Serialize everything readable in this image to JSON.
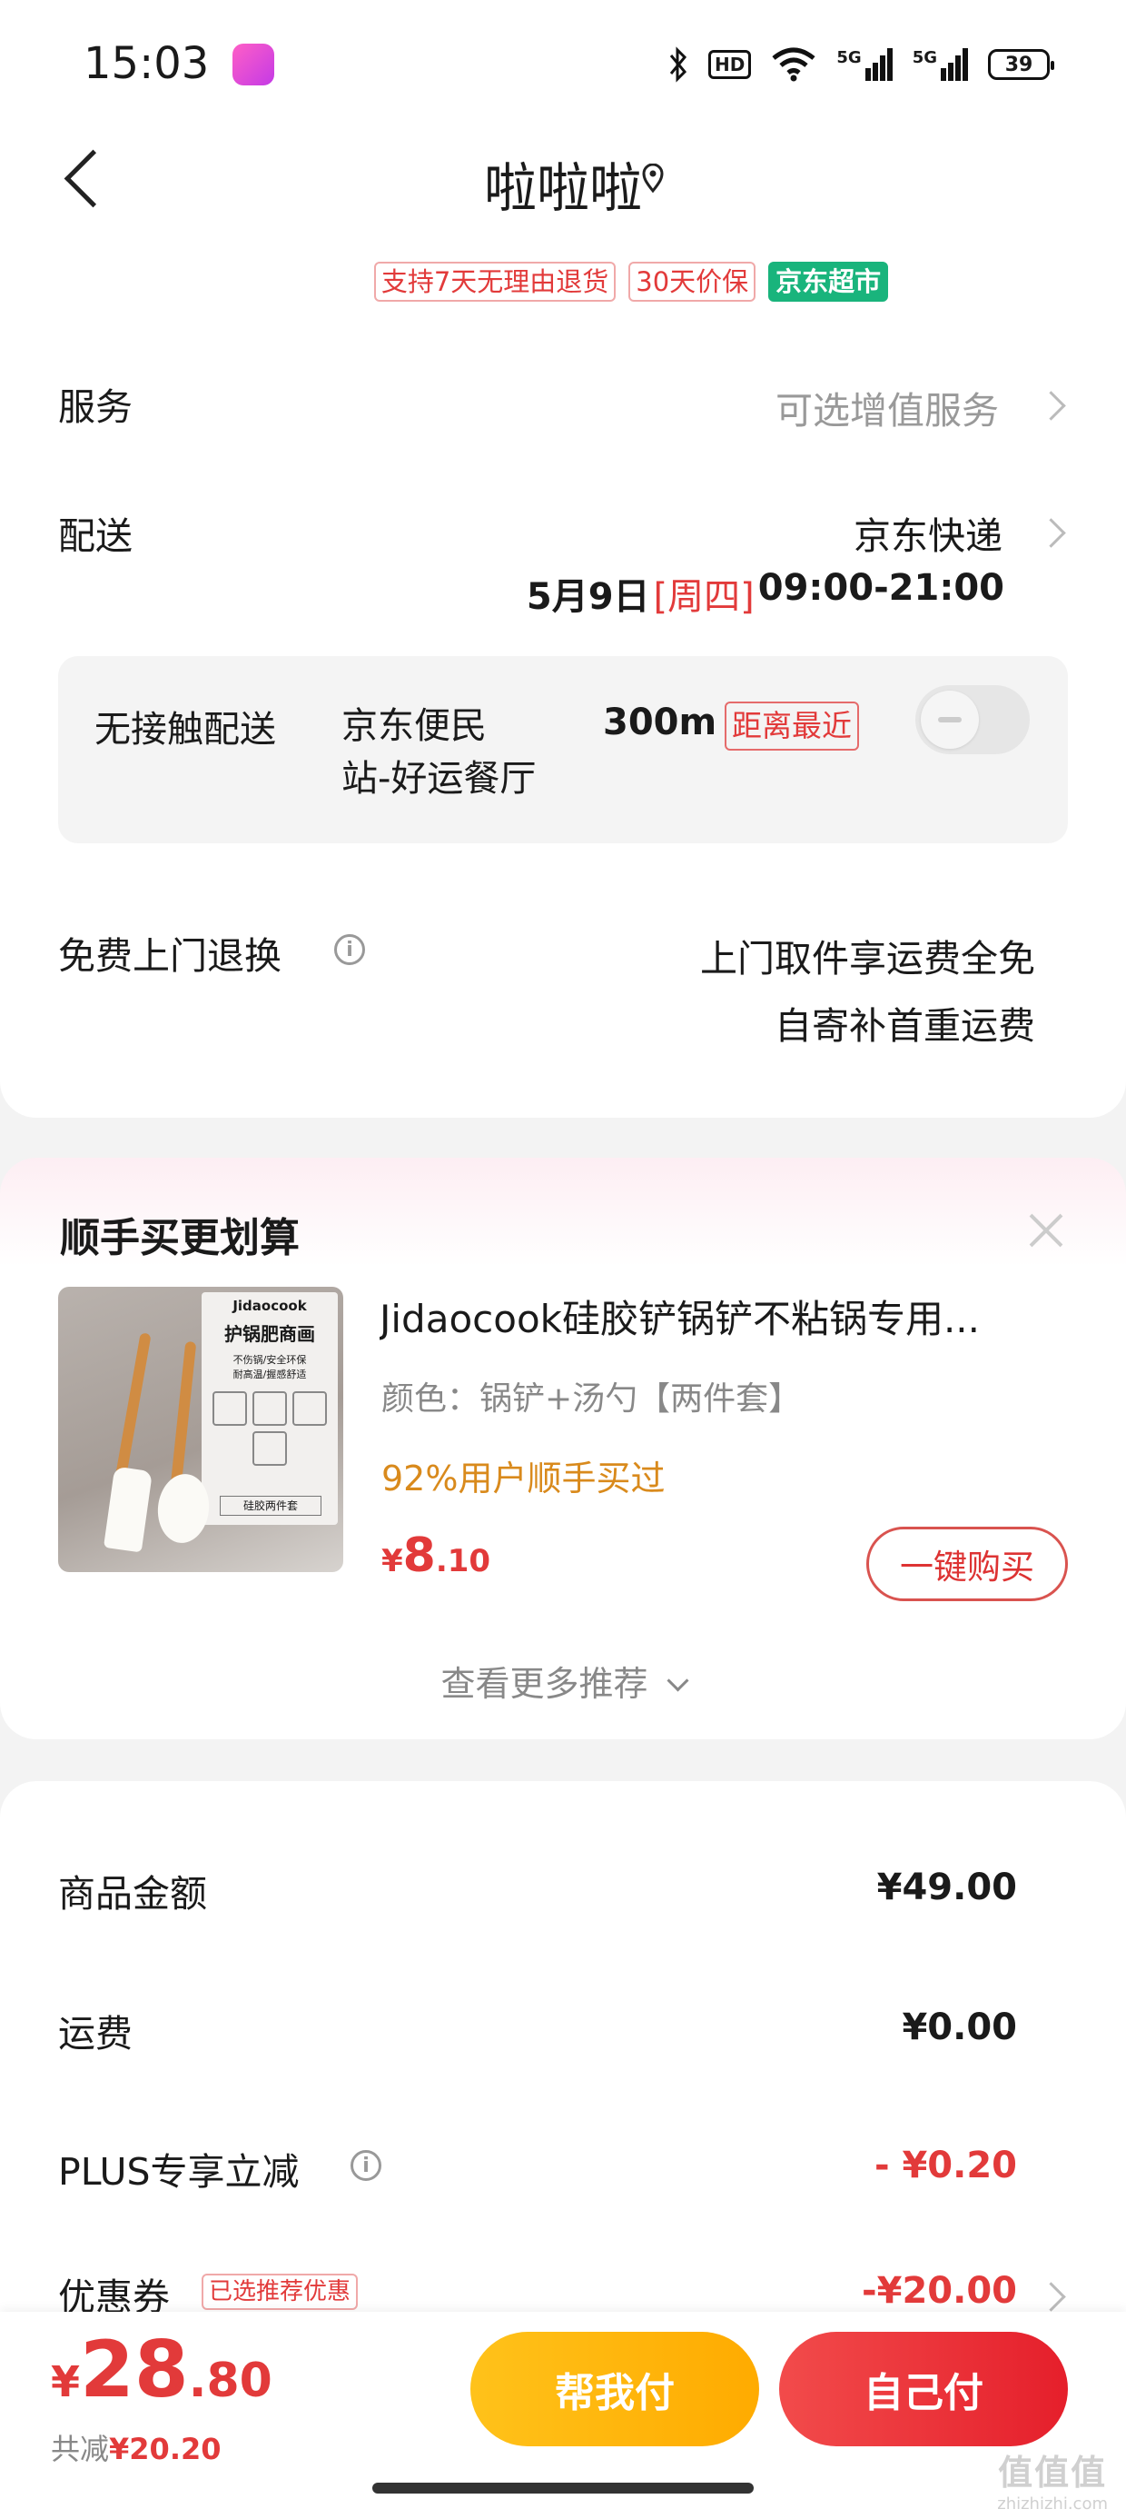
{
  "status_bar": {
    "time": "15:03",
    "bluetooth_icon": "bluetooth-icon",
    "hd_label": "HD",
    "network_1": "5G",
    "network_2": "5G",
    "battery": "39"
  },
  "header": {
    "title": "啦啦啦",
    "tags": [
      "支持7天无理由退货",
      "30天价保"
    ],
    "store_tag": "京东超市"
  },
  "service": {
    "label": "服务",
    "value": "可选增值服务"
  },
  "delivery": {
    "label": "配送",
    "carrier": "京东快递",
    "date": "5月9日",
    "weekday": "[周四]",
    "time_window": "09:00-21:00",
    "contactless_label": "无接触配送",
    "station_line1": "京东便民",
    "station_line2": "站-好运餐厅",
    "distance": "300m",
    "nearest_tag": "距离最近"
  },
  "returns": {
    "label": "免费上门退换",
    "line1": "上门取件享运费全免",
    "line2": "自寄补首重运费"
  },
  "recommend": {
    "title": "顺手买更划算",
    "product": {
      "image_brand": "Jidaocook",
      "image_heading": "护锅肥商画",
      "image_lines": [
        "不伤锅/安全环保",
        "耐高温/握感舒适"
      ],
      "image_footer": "硅胶两件套",
      "name": "Jidaocook硅胶铲锅铲不粘锅专用...",
      "variant": "颜色：锅铲+汤勺【两件套】",
      "social": "92%用户顺手买过",
      "price_symbol": "¥",
      "price_int": "8",
      "price_dec": ".10",
      "buy_label": "一键购买"
    },
    "more": "查看更多推荐"
  },
  "summary": {
    "rows": [
      {
        "label": "商品金额",
        "value": "¥49.00"
      },
      {
        "label": "运费",
        "value": "¥0.00"
      },
      {
        "label": "PLUS专享立减",
        "value": "- ¥0.20"
      },
      {
        "label": "优惠券",
        "value": "-¥20.00"
      }
    ],
    "coupon_tag": "已选推荐优惠"
  },
  "footer": {
    "total_symbol": "¥",
    "total_int": "28",
    "total_dec": ".80",
    "saved_label": "共减",
    "saved_value": "¥20.20",
    "help_pay": "帮我付",
    "self_pay": "自己付"
  },
  "watermark": {
    "glyphs": "值值值",
    "site": "zhizhizhi.com"
  },
  "colors": {
    "accent_red": "#e23a3a",
    "green_tag": "#19b47c",
    "orange": "#d98a1c",
    "yellow_button": "#ffb400"
  }
}
